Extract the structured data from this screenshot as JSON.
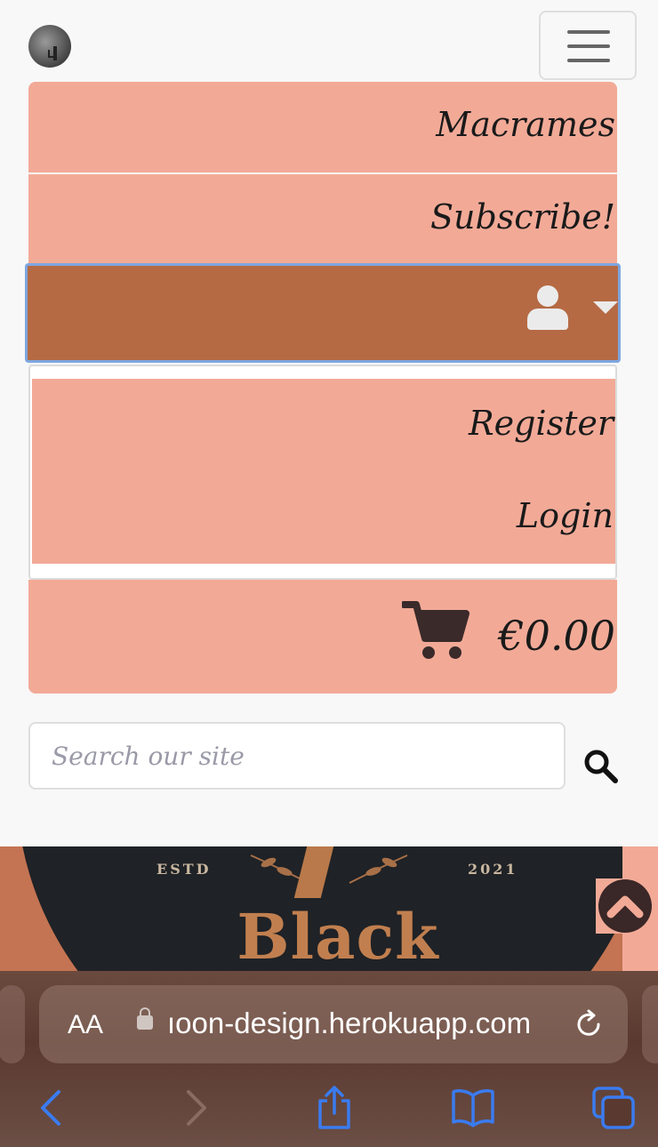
{
  "navbar": {
    "logo_alt": "Black Moon logo",
    "toggler_icon": "hamburger-icon",
    "items": {
      "macrames": "Macrames",
      "subscribe": "Subscribe!"
    },
    "account": {
      "icon": "user-icon",
      "caret_icon": "caret-down-icon",
      "dropdown": {
        "register": "Register",
        "login": "Login"
      }
    },
    "cart": {
      "icon": "cart-icon",
      "total": "€0.00"
    }
  },
  "search": {
    "placeholder": "Search our site",
    "value": "",
    "button_icon": "search-icon"
  },
  "banner": {
    "estd_label": "ESTD",
    "year": "2021",
    "title": "Black Moon"
  },
  "back_to_top": {
    "icon": "chevron-up-icon"
  },
  "browser": {
    "text_size_label": "AA",
    "url": "ıoon-design.herokuapp.com",
    "toolbar_icons": [
      "back-icon",
      "forward-icon",
      "share-icon",
      "bookmarks-icon",
      "tabs-icon"
    ]
  },
  "colors": {
    "nav_item_bg": "#f2aa97",
    "account_bg": "#b56a44",
    "focus_outline": "#7ea6de",
    "banner_dark": "#1f2226",
    "banner_title": "#c17f4f",
    "ios_blue": "#3a7bf0"
  }
}
